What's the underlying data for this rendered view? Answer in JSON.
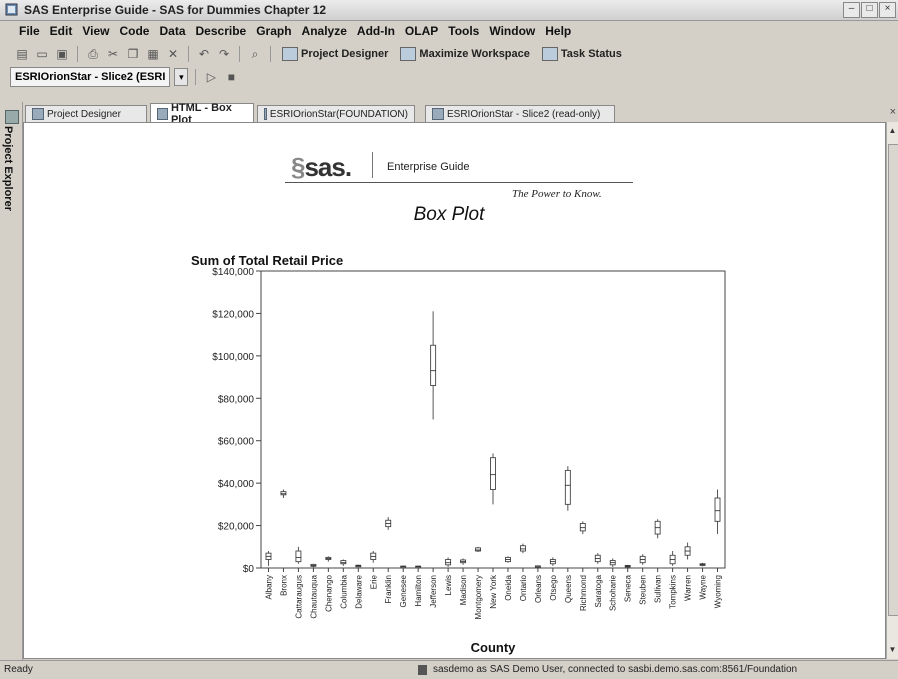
{
  "window": {
    "title": "SAS Enterprise Guide - SAS for Dummies Chapter 12",
    "controls": [
      "–",
      "□",
      "×"
    ]
  },
  "menu": [
    "File",
    "Edit",
    "View",
    "Code",
    "Data",
    "Describe",
    "Graph",
    "Analyze",
    "Add-In",
    "OLAP",
    "Tools",
    "Window",
    "Help"
  ],
  "toolbar": {
    "project_designer": "Project Designer",
    "maximize_workspace": "Maximize Workspace",
    "task_status": "Task Status"
  },
  "toolbar2": {
    "combo_value": "ESRIOrionStar - Slice2 (ESRI"
  },
  "sidebar": {
    "label": "Project Explorer"
  },
  "tabs": [
    {
      "label": "Project Designer"
    },
    {
      "label": "HTML - Box Plot"
    },
    {
      "label": "ESRIOrionStar(FOUNDATION)"
    },
    {
      "label": "ESRIOrionStar - Slice2 (read-only)"
    }
  ],
  "report": {
    "logo_text": "sas.",
    "product": "Enterprise Guide",
    "tagline": "The Power to Know."
  },
  "chart_data": {
    "type": "box",
    "title": "Box Plot",
    "ylabel": "Sum of Total Retail Price",
    "xlabel": "County",
    "ylim": [
      0,
      140000
    ],
    "y_ticks": [
      "$0",
      "$20,000",
      "$40,000",
      "$60,000",
      "$80,000",
      "$100,000",
      "$120,000",
      "$140,000"
    ],
    "grid": false,
    "categories": [
      "Albany",
      "Bronx",
      "Cattaraugus",
      "Chautauqua",
      "Chenango",
      "Columbia",
      "Delaware",
      "Erie",
      "Franklin",
      "Genesee",
      "Hamilton",
      "Jefferson",
      "Lewis",
      "Madison",
      "Montgomery",
      "New York",
      "Oneida",
      "Ontario",
      "Orleans",
      "Otsego",
      "Queens",
      "Richmond",
      "Saratoga",
      "Schoharie",
      "Seneca",
      "Steuben",
      "Sullivan",
      "Tompkins",
      "Warren",
      "Wayne",
      "Wyoming"
    ],
    "boxes": [
      {
        "category": "Albany",
        "min": 1000,
        "q1": 4000,
        "median": 5500,
        "q3": 7000,
        "max": 8000
      },
      {
        "category": "Bronx",
        "min": 33000,
        "q1": 34500,
        "median": 35000,
        "q3": 36000,
        "max": 37000
      },
      {
        "category": "Cattaraugus",
        "min": 2000,
        "q1": 3000,
        "median": 5000,
        "q3": 8000,
        "max": 10000
      },
      {
        "category": "Chautauqua",
        "min": 300,
        "q1": 800,
        "median": 1200,
        "q3": 1700,
        "max": 2000
      },
      {
        "category": "Chenango",
        "min": 3000,
        "q1": 4000,
        "median": 4500,
        "q3": 5000,
        "max": 5500
      },
      {
        "category": "Columbia",
        "min": 1000,
        "q1": 2000,
        "median": 2500,
        "q3": 3500,
        "max": 4000
      },
      {
        "category": "Delaware",
        "min": 400,
        "q1": 700,
        "median": 1000,
        "q3": 1300,
        "max": 1500
      },
      {
        "category": "Erie",
        "min": 2500,
        "q1": 4000,
        "median": 5500,
        "q3": 7000,
        "max": 8000
      },
      {
        "category": "Franklin",
        "min": 18000,
        "q1": 19500,
        "median": 21000,
        "q3": 22500,
        "max": 24000
      },
      {
        "category": "Genesee",
        "min": 200,
        "q1": 500,
        "median": 700,
        "q3": 900,
        "max": 1100
      },
      {
        "category": "Hamilton",
        "min": 200,
        "q1": 500,
        "median": 700,
        "q3": 900,
        "max": 1100
      },
      {
        "category": "Jefferson",
        "min": 70000,
        "q1": 86000,
        "median": 93000,
        "q3": 105000,
        "max": 121000
      },
      {
        "category": "Lewis",
        "min": 500,
        "q1": 1500,
        "median": 2500,
        "q3": 4000,
        "max": 5000
      },
      {
        "category": "Madison",
        "min": 1500,
        "q1": 2500,
        "median": 3000,
        "q3": 3800,
        "max": 4500
      },
      {
        "category": "Montgomery",
        "min": 7500,
        "q1": 8000,
        "median": 8500,
        "q3": 9500,
        "max": 10000
      },
      {
        "category": "New York",
        "min": 30000,
        "q1": 37000,
        "median": 44000,
        "q3": 52000,
        "max": 54000
      },
      {
        "category": "Oneida",
        "min": 2500,
        "q1": 3000,
        "median": 4000,
        "q3": 5000,
        "max": 5500
      },
      {
        "category": "Ontario",
        "min": 7000,
        "q1": 8000,
        "median": 9000,
        "q3": 10500,
        "max": 11500
      },
      {
        "category": "Orleans",
        "min": 300,
        "q1": 600,
        "median": 800,
        "q3": 1000,
        "max": 1200
      },
      {
        "category": "Otsego",
        "min": 1000,
        "q1": 2000,
        "median": 3000,
        "q3": 4000,
        "max": 5000
      },
      {
        "category": "Queens",
        "min": 27000,
        "q1": 30000,
        "median": 39000,
        "q3": 46000,
        "max": 48000
      },
      {
        "category": "Richmond",
        "min": 16000,
        "q1": 17500,
        "median": 19000,
        "q3": 21000,
        "max": 22000
      },
      {
        "category": "Saratoga",
        "min": 2000,
        "q1": 3000,
        "median": 4500,
        "q3": 6000,
        "max": 7000
      },
      {
        "category": "Schoharie",
        "min": 500,
        "q1": 1500,
        "median": 2500,
        "q3": 3500,
        "max": 4500
      },
      {
        "category": "Seneca",
        "min": 300,
        "q1": 600,
        "median": 900,
        "q3": 1200,
        "max": 1500
      },
      {
        "category": "Steuben",
        "min": 1500,
        "q1": 2500,
        "median": 4000,
        "q3": 5500,
        "max": 6500
      },
      {
        "category": "Sullivan",
        "min": 14000,
        "q1": 16000,
        "median": 19000,
        "q3": 22000,
        "max": 23000
      },
      {
        "category": "Tompkins",
        "min": 1000,
        "q1": 2000,
        "median": 4000,
        "q3": 6000,
        "max": 8000
      },
      {
        "category": "Warren",
        "min": 4000,
        "q1": 6000,
        "median": 8000,
        "q3": 10000,
        "max": 12000
      },
      {
        "category": "Wayne",
        "min": 800,
        "q1": 1200,
        "median": 1600,
        "q3": 2000,
        "max": 2400
      },
      {
        "category": "Wyoming",
        "min": 16000,
        "q1": 22000,
        "median": 27000,
        "q3": 33000,
        "max": 37000
      }
    ]
  },
  "status": {
    "left": "Ready",
    "right": "sasdemo as SAS Demo User, connected to sasbi.demo.sas.com:8561/Foundation"
  }
}
